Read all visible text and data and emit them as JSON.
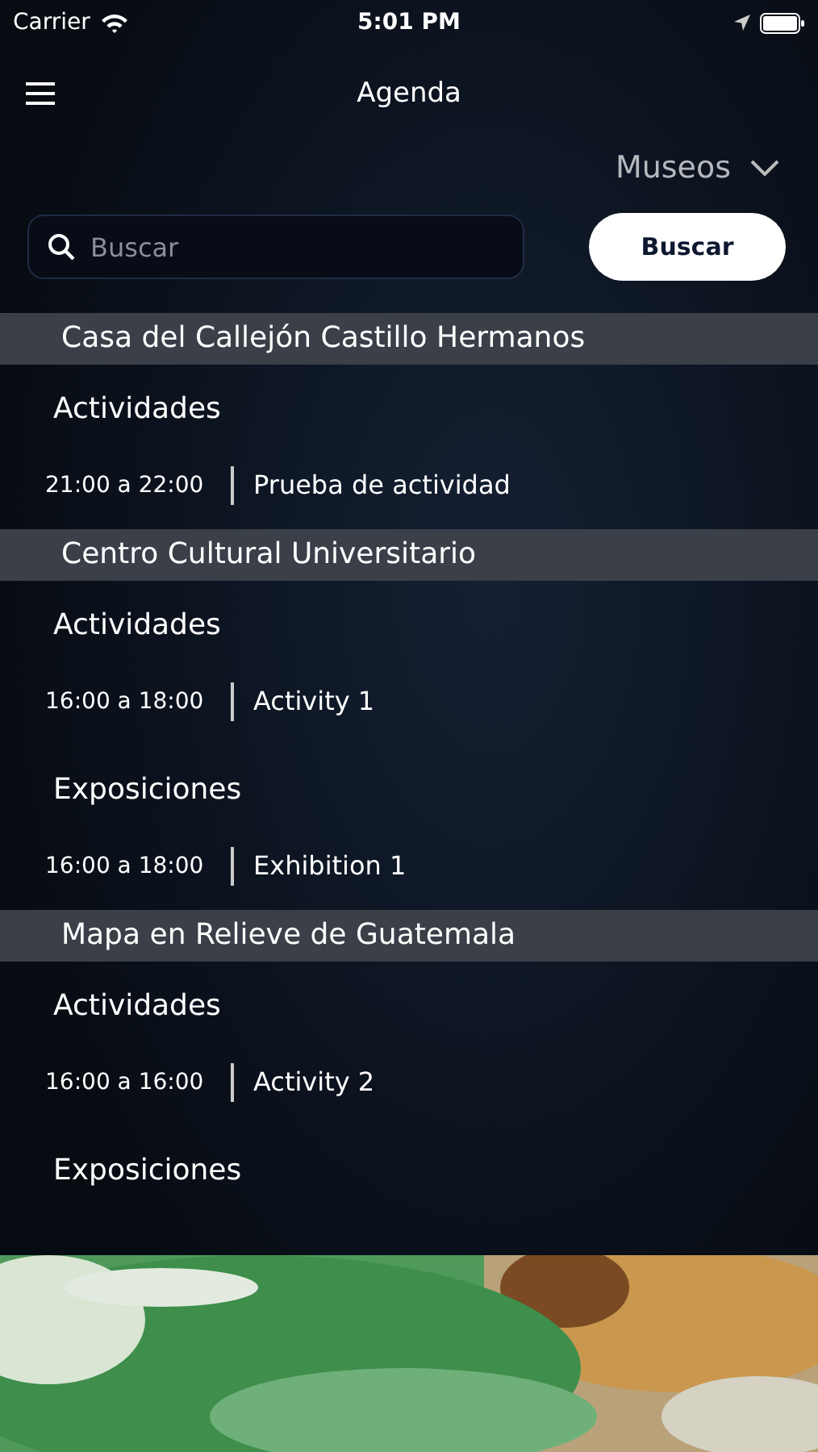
{
  "status_bar": {
    "carrier": "Carrier",
    "time": "5:01 PM"
  },
  "nav": {
    "title": "Agenda"
  },
  "filter": {
    "label": "Museos"
  },
  "search": {
    "placeholder": "Buscar",
    "button": "Buscar"
  },
  "venues": [
    {
      "name": "Casa del Callejón Castillo Hermanos",
      "groups": [
        {
          "title": "Actividades",
          "events": [
            {
              "time": "21:00 a 22:00",
              "title": "Prueba de actividad"
            }
          ]
        }
      ]
    },
    {
      "name": "Centro Cultural Universitario",
      "groups": [
        {
          "title": "Actividades",
          "events": [
            {
              "time": "16:00 a 18:00",
              "title": "Activity 1"
            }
          ]
        },
        {
          "title": "Exposiciones",
          "events": [
            {
              "time": "16:00 a 18:00",
              "title": "Exhibition 1"
            }
          ]
        }
      ]
    },
    {
      "name": "Mapa en Relieve de Guatemala",
      "groups": [
        {
          "title": "Actividades",
          "events": [
            {
              "time": "16:00 a 16:00",
              "title": "Activity 2"
            }
          ]
        },
        {
          "title": "Exposiciones"
        }
      ]
    }
  ]
}
